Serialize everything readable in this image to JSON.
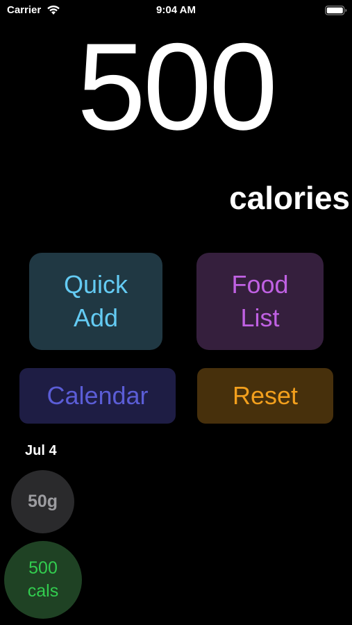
{
  "status_bar": {
    "carrier": "Carrier",
    "time": "9:04 AM",
    "wifi_icon": "wifi-icon",
    "battery_icon": "battery-icon"
  },
  "summary": {
    "value": "500",
    "unit": "calories"
  },
  "actions": {
    "quick_add": "Quick\nAdd",
    "food_list": "Food\nList",
    "calendar": "Calendar",
    "reset": "Reset"
  },
  "log": {
    "date": "Jul 4",
    "entries": [
      {
        "label": "50g"
      },
      {
        "label": "500\ncals"
      }
    ]
  },
  "colors": {
    "quick_add_text": "#64cbf3",
    "food_list_text": "#c061e3",
    "calendar_text": "#5b5dd6",
    "reset_text": "#f29f1d",
    "protein_text": "#9c9ca0",
    "calories_text": "#32cd4f"
  }
}
